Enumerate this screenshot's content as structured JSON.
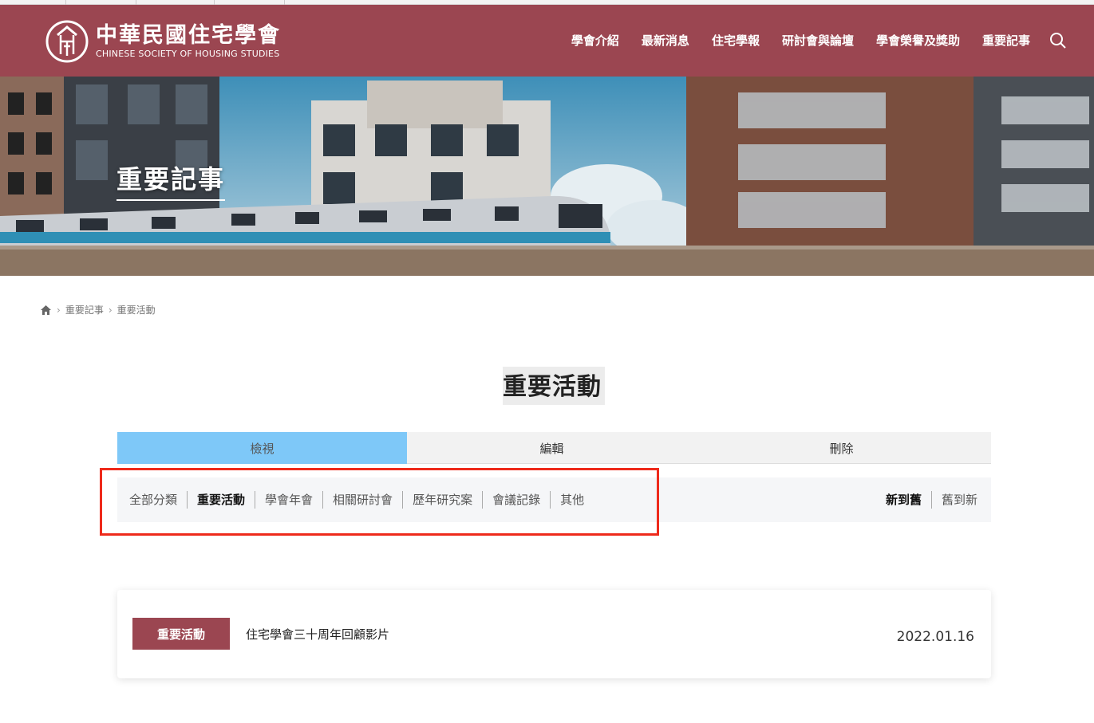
{
  "colors": {
    "header_bg": "#9b4651",
    "tab_active_bg": "#7ec8f8",
    "badge_bg": "#9b4651",
    "highlight_border": "#ee2a1b"
  },
  "logo": {
    "name_cn": "中華民國住宅學會",
    "name_en": "CHINESE SOCIETY OF HOUSING STUDIES",
    "icon": "society-logo-icon"
  },
  "nav": {
    "items": [
      {
        "label": "學會介紹"
      },
      {
        "label": "最新消息"
      },
      {
        "label": "住宅學報"
      },
      {
        "label": "研討會與論壇"
      },
      {
        "label": "學會榮譽及獎助"
      },
      {
        "label": "重要記事"
      }
    ],
    "search_icon": "search-icon"
  },
  "banner": {
    "title": "重要記事"
  },
  "breadcrumb": {
    "home_icon": "home-icon",
    "items": [
      {
        "label": "重要記事"
      },
      {
        "label": "重要活動"
      }
    ]
  },
  "page": {
    "title": "重要活動"
  },
  "tabs": [
    {
      "label": "檢視",
      "active": true
    },
    {
      "label": "編輯",
      "active": false
    },
    {
      "label": "刪除",
      "active": false
    }
  ],
  "categories": [
    {
      "label": "全部分類",
      "active": false
    },
    {
      "label": "重要活動",
      "active": true
    },
    {
      "label": "學會年會",
      "active": false
    },
    {
      "label": "相關研討會",
      "active": false
    },
    {
      "label": "歷年研究案",
      "active": false
    },
    {
      "label": "會議記錄",
      "active": false
    },
    {
      "label": "其他",
      "active": false
    }
  ],
  "sort": [
    {
      "label": "新到舊",
      "active": true
    },
    {
      "label": "舊到新",
      "active": false
    }
  ],
  "posts": [
    {
      "category": "重要活動",
      "title": "住宅學會三十周年回顧影片",
      "date": "2022.01.16"
    }
  ]
}
